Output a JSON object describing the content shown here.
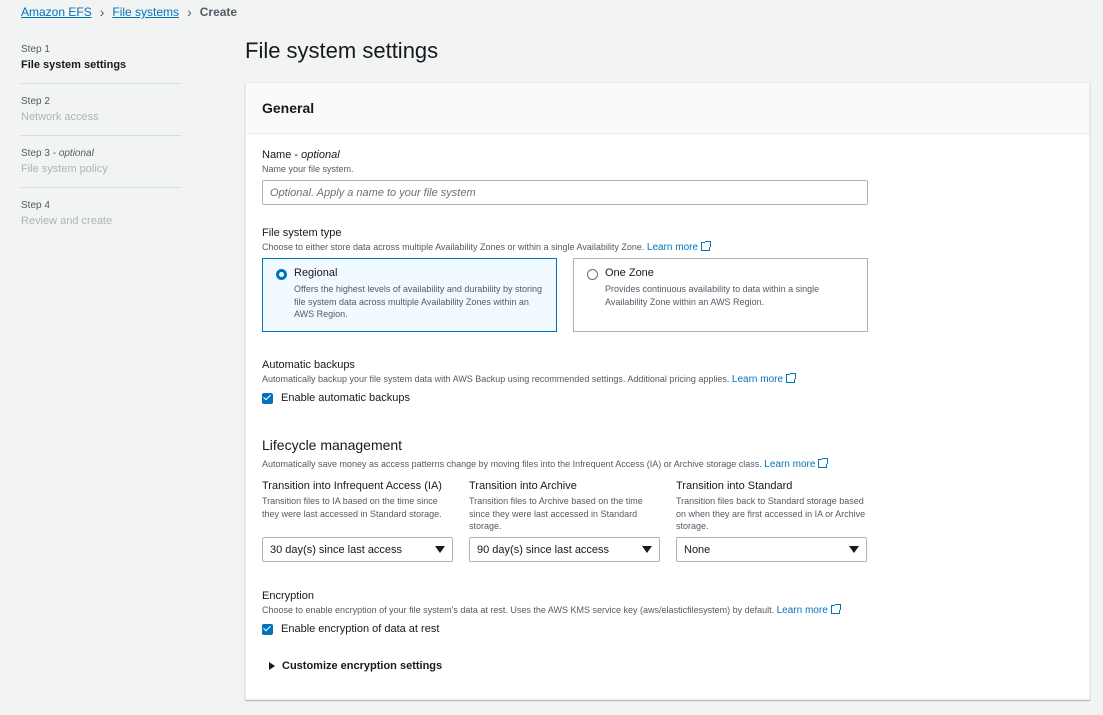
{
  "breadcrumb": {
    "items": [
      "Amazon EFS",
      "File systems"
    ],
    "current": "Create"
  },
  "steps": [
    {
      "num": "Step 1",
      "optional": "",
      "title": "File system settings"
    },
    {
      "num": "Step 2",
      "optional": "",
      "title": "Network access"
    },
    {
      "num": "Step 3 - ",
      "optional": "optional",
      "title": "File system policy"
    },
    {
      "num": "Step 4",
      "optional": "",
      "title": "Review and create"
    }
  ],
  "page_title": "File system settings",
  "panel": {
    "header": "General",
    "name": {
      "label": "Name - ",
      "label_optional": "optional",
      "desc": "Name your file system.",
      "placeholder": "Optional. Apply a name to your file system",
      "value": ""
    },
    "fs_type": {
      "label": "File system type",
      "desc": "Choose to either store data across multiple Availability Zones or within a single Availability Zone.",
      "learn_more": "Learn more",
      "options": [
        {
          "title": "Regional",
          "desc": "Offers the highest levels of availability and durability by storing file system data across multiple Availability Zones within an AWS Region.",
          "selected": true
        },
        {
          "title": "One Zone",
          "desc": "Provides continuous availability to data within a single Availability Zone within an AWS Region.",
          "selected": false
        }
      ]
    },
    "backups": {
      "label": "Automatic backups",
      "desc": "Automatically backup your file system data with AWS Backup using recommended settings. Additional pricing applies.",
      "learn_more": "Learn more",
      "checkbox_label": "Enable automatic backups",
      "checked": true
    },
    "lifecycle": {
      "title": "Lifecycle management",
      "desc": "Automatically save money as access patterns change by moving files into the Infrequent Access (IA) or Archive storage class.",
      "learn_more": "Learn more",
      "columns": [
        {
          "title": "Transition into Infrequent Access (IA)",
          "desc": "Transition files to IA based on the time since they were last accessed in Standard storage.",
          "value": "30 day(s) since last access"
        },
        {
          "title": "Transition into Archive",
          "desc": "Transition files to Archive based on the time since they were last accessed in Standard storage.",
          "value": "90 day(s) since last access"
        },
        {
          "title": "Transition into Standard",
          "desc": "Transition files back to Standard storage based on when they are first accessed in IA or Archive storage.",
          "value": "None"
        }
      ]
    },
    "encryption": {
      "label": "Encryption",
      "desc": "Choose to enable encryption of your file system's data at rest. Uses the AWS KMS service key (aws/elasticfilesystem) by default.",
      "learn_more": "Learn more",
      "checkbox_label": "Enable encryption of data at rest",
      "checked": true,
      "customize": "Customize encryption settings"
    }
  },
  "colors": {
    "link": "#0073bb",
    "background": "#f2f3f3",
    "selected_tile": "#f1faff"
  }
}
